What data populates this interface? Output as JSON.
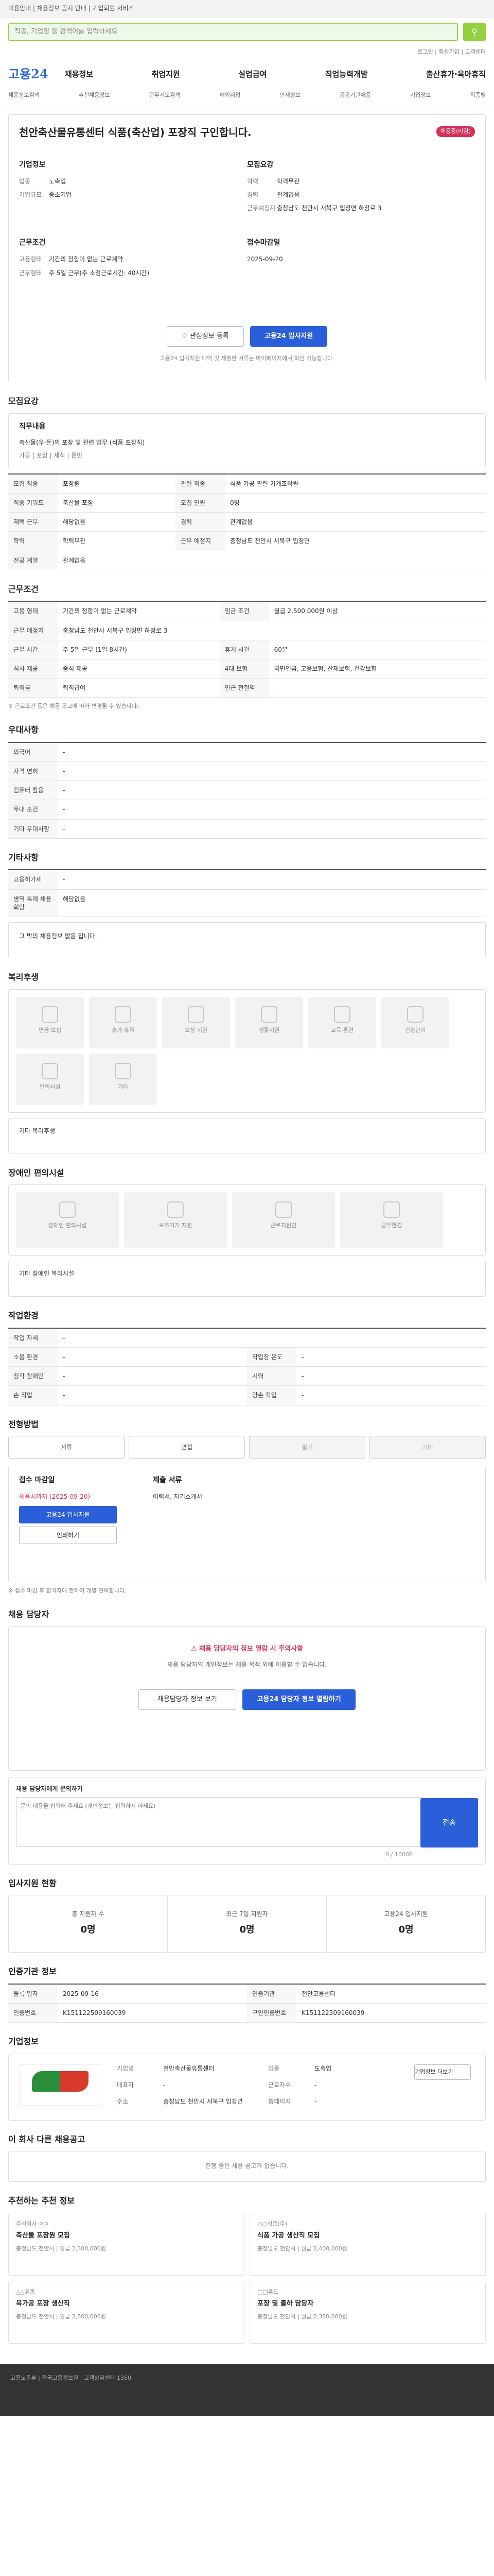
{
  "topbar": {
    "notice": "이용안내 | 채용정보 공지 안내 | 기업회원 서비스"
  },
  "search": {
    "placeholder": "직종, 기업명 등 검색어를 입력하세요",
    "button": "검색"
  },
  "util": {
    "links": "로그인 | 회원가입 | 고객센터"
  },
  "site": {
    "logo": "고용24"
  },
  "menu": {
    "items": [
      "채용정보",
      "취업지원",
      "실업급여",
      "직업능력개발",
      "출산휴가·육아휴직"
    ]
  },
  "submenu": {
    "items": [
      "채용정보검색",
      "추천채용정보",
      "근무지도검색",
      "해외취업",
      "인재정보",
      "공공기관채용",
      "기업정보",
      "직종별"
    ]
  },
  "job": {
    "title": "천안축산물유통센터 식품(축산업) 포장직 구인합니다.",
    "badge": "채용중(마감)",
    "company_label": "기업정보",
    "company_name": "천안축산물유통센터",
    "co_kind_k": "업종",
    "co_kind_v": "도축업",
    "co_size_k": "기업규모",
    "co_size_v": "중소기업",
    "recruit_label": "모집요강",
    "rec_edu_k": "학력",
    "rec_edu_v": "학력무관",
    "rec_career_k": "경력",
    "rec_career_v": "관계없음",
    "work_label": "근무조건",
    "work_type_k": "고용형태",
    "work_type_v": "기간의 정함이 없는 근로계약",
    "work_shift_k": "근무형태",
    "work_shift_v": "주 5일 근무(주 소정근로시간: 40시간)",
    "place_label": "근무예정지",
    "place_addr": "충청남도 천안시 서북구 입장면 하장로 3",
    "apply_label": "접수마감일",
    "apply_deadline": "2025-09-20",
    "save_btn": "관심정보 등록",
    "apply_btn": "고용24 입사지원",
    "hint": "고용24 입사지원 내역 및 제출한 서류는 마이페이지에서 확인 가능합니다."
  },
  "duty": {
    "title": "모집요강",
    "desc_title": "직무내용",
    "desc": "축산물(우·돈)의 포장 및 관련 업무 (식품 포장직)",
    "desc2": "가공 | 포장 | 세척 | 운반",
    "rows": [
      [
        "모집 직종",
        "포장원",
        "관련 직종",
        "식품 가공 관련 기계조작원"
      ],
      [
        "직종 키워드",
        "축산물 포장",
        "모집 인원",
        "0명"
      ],
      [
        "재택 근무",
        "해당없음",
        "경력",
        "관계없음"
      ],
      [
        "학력",
        "학력무관",
        "근무 예정지",
        "충청남도 천안시 서북구 입장면"
      ],
      [
        "전공 계열",
        "관계없음",
        "",
        ""
      ]
    ]
  },
  "conditions": {
    "title": "근무조건",
    "rows": [
      [
        "고용 형태",
        "기간의 정함이 없는 근로계약",
        "임금 조건",
        "월급 2,500,000원 이상"
      ],
      [
        "근무 예정지",
        "충청남도 천안시 서북구 입장면 하장로 3",
        "",
        ""
      ],
      [
        "근무 시간",
        "주 5일 근무 (1일 8시간)",
        "휴게 시간",
        "60분"
      ],
      [
        "식사 제공",
        "중식 제공",
        "4대 보험",
        "국민연금, 고용보험, 산재보험, 건강보험"
      ],
      [
        "퇴직금",
        "퇴직급여",
        "인근 전철역",
        "-"
      ]
    ],
    "note": "※ 근로조건 등은 채용 공고에 따라 변경될 수 있습니다."
  },
  "etc": {
    "title": "우대사항",
    "rows": [
      [
        "외국어",
        "-"
      ],
      [
        "자격 면허",
        "-"
      ],
      [
        "컴퓨터 활용",
        "-"
      ],
      [
        "우대 조건",
        "-"
      ],
      [
        "기타 우대사항",
        "-"
      ]
    ]
  },
  "other": {
    "title": "기타사항",
    "rows": [
      [
        "고용허가제",
        "-"
      ],
      [
        "병역 특례 채용 희망",
        "해당없음"
      ]
    ],
    "box": "그 밖의 채용정보 없음 입니다."
  },
  "welfare": {
    "title": "복리후생",
    "items": [
      "연금·보험",
      "휴가·휴직",
      "보상·지원",
      "생활지원",
      "교육·훈련",
      "건강관리",
      "편의시설",
      "기타"
    ],
    "box": "기타 복리후생"
  },
  "disabled": {
    "title": "장애인 편의시설",
    "items": [
      "장애인 편의시설",
      "보조기기 지원",
      "근로지원인",
      "근무환경"
    ],
    "box": "기타 장애인 복리시설"
  },
  "workenv": {
    "title": "작업환경",
    "rows": [
      [
        "작업 자세",
        "-",
        "",
        ""
      ],
      [
        "소음 환경",
        "-",
        "작업장 온도",
        "-"
      ],
      [
        "청각 장애인",
        "-",
        "시력",
        "-"
      ],
      [
        "손 작업",
        "-",
        "양손 작업",
        "-"
      ]
    ]
  },
  "process": {
    "title": "전형방법",
    "tabs": [
      "서류",
      "면접",
      "필기",
      "기타"
    ],
    "apply_method_title": "접수 마감일",
    "apply_method_v": "채용시까지 (2025-09-20)",
    "apply_btn": "고용24 입사지원",
    "print_btn": "인쇄하기",
    "doc_title": "제출 서류",
    "doc_v": "이력서, 자기소개서",
    "notes": "※ 접수 마감 후 합격자에 한하여 개별 연락합니다."
  },
  "contact": {
    "title": "채용 담당자",
    "warn": "채용 담당자의 정보 열람 시 주의사항",
    "desc": "채용 담당자의 개인정보는 채용 목적 외에 이용할 수 없습니다.",
    "btn1": "채용담당자 정보 보기",
    "btn2": "고용24 담당자 정보 열람하기"
  },
  "qna": {
    "title": "채용 담당자에게 문의하기",
    "placeholder": "문의 내용을 입력해 주세요 (개인정보는 입력하지 마세요)",
    "send": "전송",
    "counter": "0 / 1000자"
  },
  "stats": {
    "title": "입사지원 현황",
    "items": [
      [
        "총 지원자 수",
        "0명"
      ],
      [
        "최근 7일 지원자",
        "0명"
      ],
      [
        "고용24 입사지원",
        "0명"
      ]
    ]
  },
  "regist": {
    "title": "인증기관 정보",
    "rows": [
      [
        "등록 일자",
        "2025-09-16",
        "인증기관",
        "천안고용센터"
      ],
      [
        "인증번호",
        "K151122509160039",
        "구인인증번호",
        "K151122509160039"
      ]
    ]
  },
  "company": {
    "title": "기업정보",
    "rows": [
      [
        "기업명",
        "천안축산물유통센터",
        "업종",
        "도축업"
      ],
      [
        "대표자",
        "-",
        "근로자수",
        "-"
      ],
      [
        "주소",
        "충청남도 천안시 서북구 입장면",
        "홈페이지",
        "-"
      ]
    ],
    "btn": "기업정보 더보기"
  },
  "recommend": {
    "title": "이 회사 다른 채용공고",
    "empty": "진행 중인 채용 공고가 없습니다.",
    "title2": "추천하는 추천 정보",
    "items": [
      {
        "co": "주식회사 ㅇㅇ",
        "t": "축산물 포장원 모집",
        "m": "충청남도 천안시 | 월급 2,300,000원"
      },
      {
        "co": "○○식품(주)",
        "t": "식품 가공 생산직 모집",
        "m": "충청남도 천안시 | 월급 2,400,000원"
      },
      {
        "co": "△△유통",
        "t": "육가공 포장 생산직",
        "m": "충청남도 천안시 | 월급 2,500,000원"
      },
      {
        "co": "□□푸드",
        "t": "포장 및 출하 담당자",
        "m": "충청남도 천안시 | 월급 2,350,000원"
      }
    ]
  },
  "footer": {
    "text": "고용노동부 | 한국고용정보원 | 고객상담센터 1350"
  }
}
